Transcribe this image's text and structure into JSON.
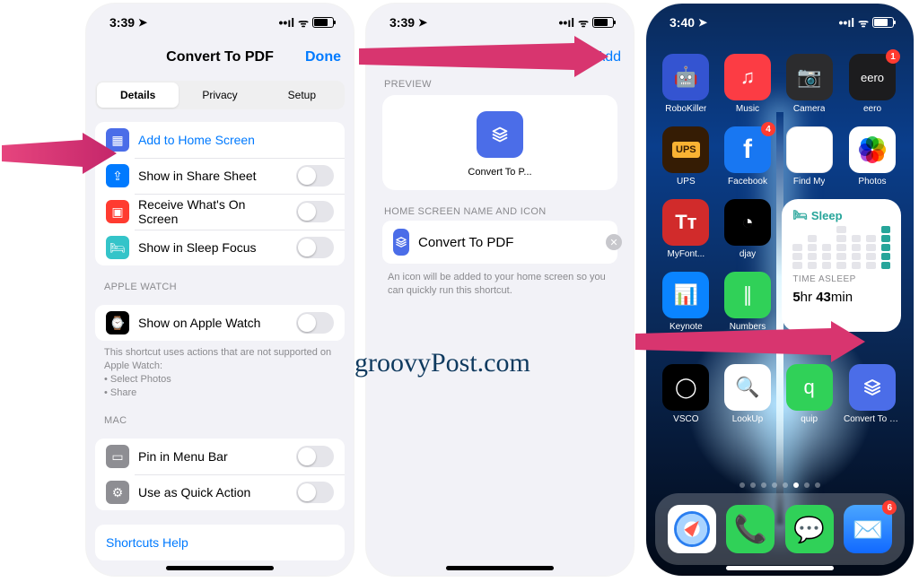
{
  "screen1": {
    "status": {
      "time": "3:39",
      "location": "➤",
      "signal": 4,
      "wifi": "●",
      "battery": 70
    },
    "header": {
      "title": "Convert To PDF",
      "done": "Done"
    },
    "segments": {
      "details": "Details",
      "privacy": "Privacy",
      "setup": "Setup",
      "selected": 0
    },
    "actions": {
      "add_home": "Add to Home Screen",
      "share_sheet": "Show in Share Sheet",
      "receive_screen": "Receive What's On Screen",
      "sleep_focus": "Show in Sleep Focus"
    },
    "apple_watch": {
      "section": "APPLE WATCH",
      "show": "Show on Apple Watch",
      "hint": "This shortcut uses actions that are not supported on Apple Watch:\n• Select Photos\n• Share"
    },
    "mac": {
      "section": "MAC",
      "pin": "Pin in Menu Bar",
      "quick": "Use as Quick Action"
    },
    "help": "Shortcuts Help"
  },
  "screen2": {
    "status": {
      "time": "3:39"
    },
    "header": {
      "add": "Add"
    },
    "preview_section": "PREVIEW",
    "preview_label": "Convert To P...",
    "name_section": "HOME SCREEN NAME AND ICON",
    "name_value": "Convert To PDF",
    "name_hint": "An icon will be added to your home screen so you can quickly run this shortcut."
  },
  "screen3": {
    "status": {
      "time": "3:40"
    },
    "apps_row1": [
      {
        "name": "RoboKiller",
        "tile": "t-robo",
        "glyph": "🤖"
      },
      {
        "name": "Music",
        "tile": "t-music",
        "glyph": "♫"
      },
      {
        "name": "Camera",
        "tile": "t-camera",
        "glyph": "📷"
      },
      {
        "name": "eero",
        "tile": "t-eero",
        "glyph": "eero",
        "badge": "1"
      }
    ],
    "apps_row2": [
      {
        "name": "UPS",
        "tile": "t-ups",
        "glyph": "UPS"
      },
      {
        "name": "Facebook",
        "tile": "t-fb",
        "glyph": "f",
        "badge": "4"
      },
      {
        "name": "Find My",
        "tile": "t-findmy",
        "glyph": "◎"
      },
      {
        "name": "Photos",
        "tile": "t-photos",
        "glyph": ""
      }
    ],
    "apps_row3_left": [
      {
        "name": "MyFont...",
        "tile": "t-font",
        "glyph": "Tᴛ"
      },
      {
        "name": "djay",
        "tile": "t-djay",
        "glyph": "◔"
      }
    ],
    "apps_row4_left": [
      {
        "name": "Keynote",
        "tile": "t-keynote",
        "glyph": "📊"
      },
      {
        "name": "Numbers",
        "tile": "t-numbers",
        "glyph": "∥"
      }
    ],
    "widget": {
      "title": "Sleep",
      "sub": "TIME ASLEEP",
      "value_h": "5",
      "value_hr": "hr ",
      "value_m": "43",
      "value_min": "min",
      "caption": "Sleep"
    },
    "apps_row5": [
      {
        "name": "VSCO",
        "tile": "t-vsco",
        "glyph": "◯"
      },
      {
        "name": "LookUp",
        "tile": "t-lookup",
        "glyph": "🔍"
      },
      {
        "name": "quip",
        "tile": "t-quip",
        "glyph": "q"
      },
      {
        "name": "Convert To PDF",
        "tile": "t-pdf",
        "glyph": ""
      }
    ],
    "dock": [
      {
        "name": "Safari",
        "tile": "t-safari"
      },
      {
        "name": "Phone",
        "tile": "t-phone",
        "glyph": "✆"
      },
      {
        "name": "Messages",
        "tile": "t-msg",
        "glyph": "✉"
      },
      {
        "name": "Mail",
        "tile": "t-mail",
        "glyph": "✉",
        "badge": "6"
      }
    ],
    "page_dots": {
      "count": 8,
      "active": 5
    }
  },
  "watermark": "groovyPost.com"
}
